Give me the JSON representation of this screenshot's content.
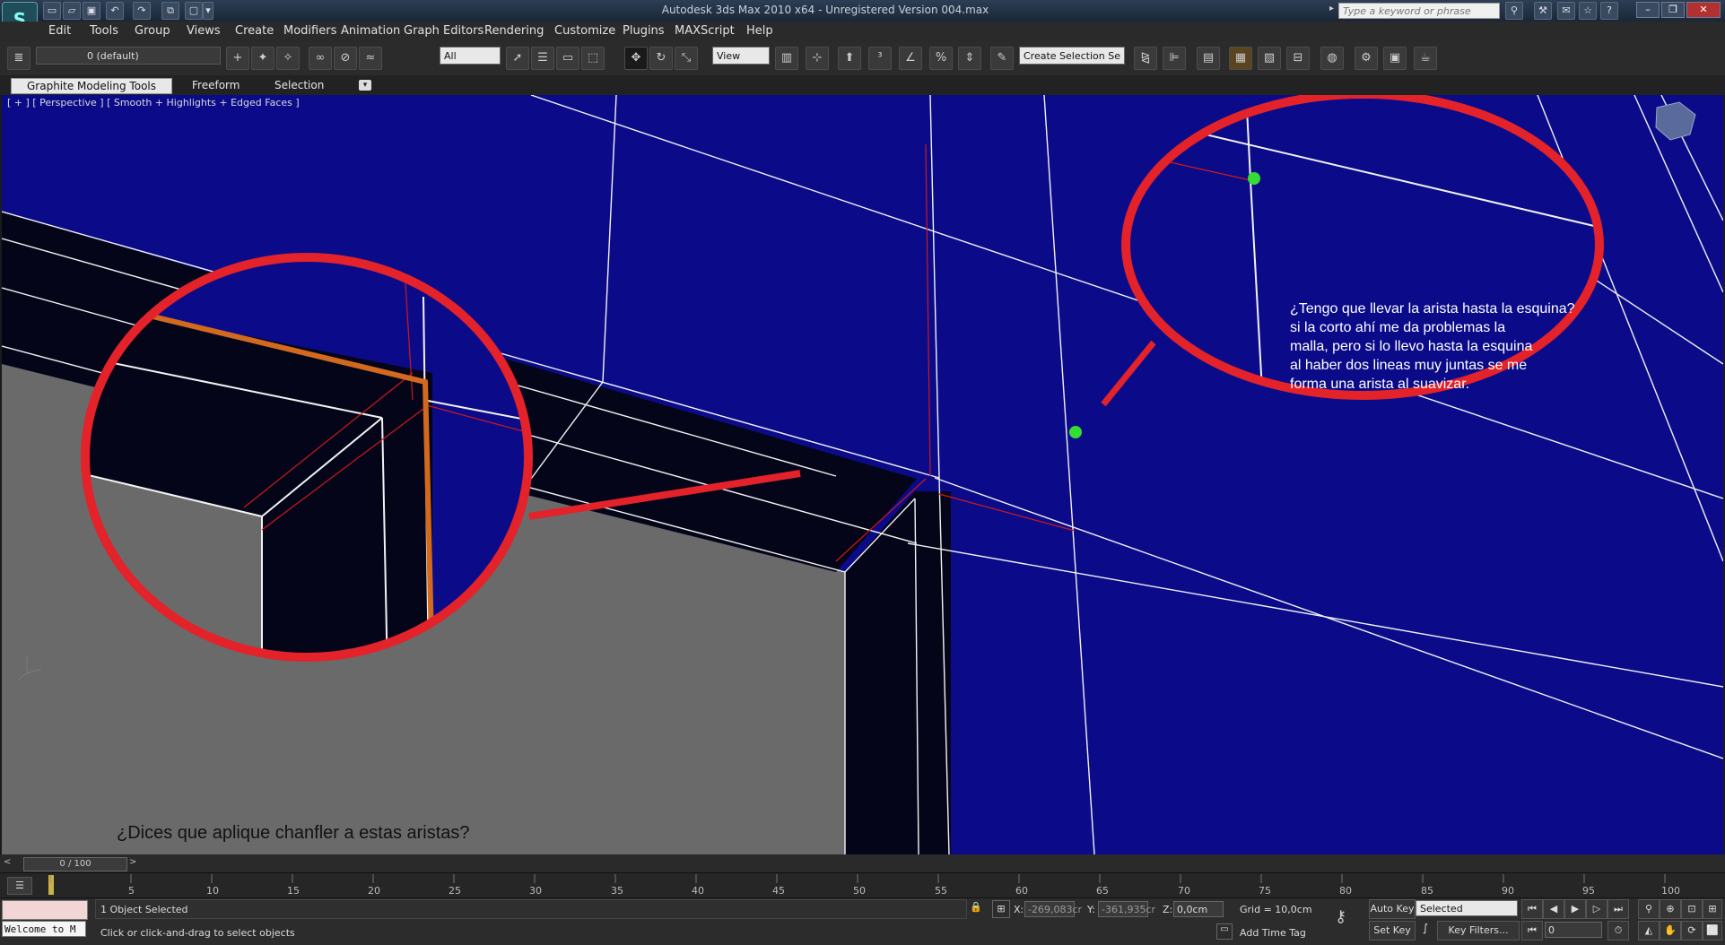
{
  "window": {
    "title": "Autodesk 3ds Max  2010 x64    - Unregistered Version       004.max",
    "search_placeholder": "Type a keyword or phrase"
  },
  "menu": [
    "Edit",
    "Tools",
    "Group",
    "Views",
    "Create",
    "Modifiers",
    "Animation",
    "Graph Editors",
    "Rendering",
    "Customize",
    "Plugins",
    "MAXScript",
    "Help"
  ],
  "toolbar": {
    "layer_label": "0 (default)",
    "selection_filter": "All",
    "reference_coord": "View",
    "named_selection": "Create Selection Se"
  },
  "ribbon": {
    "tabs": [
      "Graphite Modeling Tools",
      "Freeform",
      "Selection"
    ]
  },
  "viewport": {
    "label": "[ + ] [ Perspective ] [ Smooth + Highlights + Edged Faces ]",
    "annotation_right": "¿Tengo que llevar la arista hasta la esquina?\n si la corto ahí me da problemas la\nmalla, pero si lo llevo hasta la esquina\nal haber dos lineas muy juntas se me\nforma una arista al suavizar.",
    "annotation_left": "¿Dices que aplique chanfler a estas aristas?",
    "colors": {
      "background": "#0b0b8a",
      "annotation": "#e3222a",
      "highlight_edge": "#d2691e",
      "vertex": "#33dd33"
    }
  },
  "timeline": {
    "slider_label": "0 / 100",
    "ticks": [
      "5",
      "10",
      "15",
      "20",
      "25",
      "30",
      "35",
      "40",
      "45",
      "50",
      "55",
      "60",
      "65",
      "70",
      "75",
      "80",
      "85",
      "90",
      "95",
      "100"
    ]
  },
  "status": {
    "selection_count": "1 Object Selected",
    "prompt": "Click or click-and-drag to select objects",
    "maxscript_welcome": "Welcome to M",
    "x_value": "-269,083cr",
    "y_value": "-361,935cr",
    "z_value": "0,0cm",
    "grid": "Grid = 10,0cm",
    "add_time_tag": "Add Time Tag",
    "auto_key": "Auto Key",
    "set_key": "Set Key",
    "key_mode": "Selected",
    "key_filters": "Key Filters...",
    "frame": "0",
    "x_label": "X:",
    "y_label": "Y:",
    "z_label": "Z:"
  }
}
